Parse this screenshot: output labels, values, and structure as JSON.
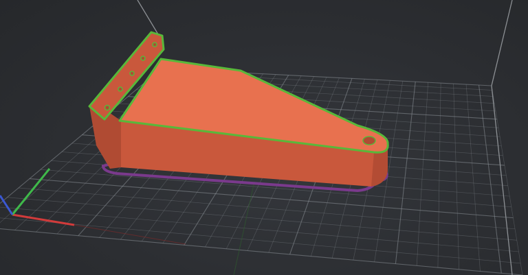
{
  "viewport": {
    "background_color": "#2c2e32",
    "bed_grid_color": "#8a9096",
    "bed_outline_color": "#b8bcc0"
  },
  "model": {
    "fill_color": "#e8714f",
    "side_color": "#c9583c",
    "shadow_side_color": "#b04b33",
    "perimeter_color": "#58b83a",
    "skirt_color": "#7a3a8c",
    "hole_count_on_flange": 5,
    "hole_count_on_arm": 1
  },
  "axes": {
    "x_color": "#d23b3b",
    "y_color": "#3fb94a",
    "z_color": "#3b58d2"
  }
}
